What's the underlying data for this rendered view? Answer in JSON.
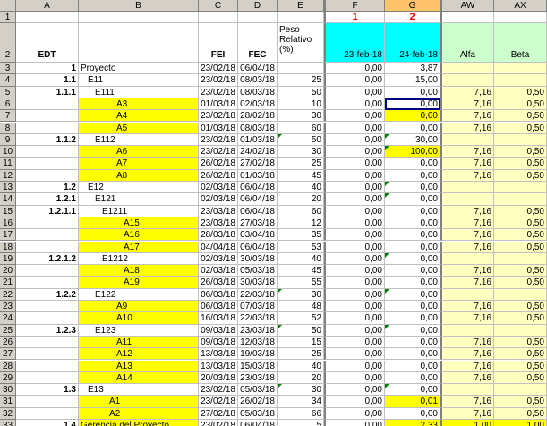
{
  "columns": [
    "A",
    "B",
    "C",
    "D",
    "E",
    "F",
    "G",
    "AW",
    "AX"
  ],
  "markers": {
    "F": "1",
    "G": "2"
  },
  "header_row": {
    "edt": "EDT",
    "fei": "FEI",
    "fec": "FEC",
    "peso": "Peso Relativo (%)",
    "f": "23-feb-18",
    "g": "24-feb-18",
    "aw": "Alfa",
    "ax": "Beta"
  },
  "rows": [
    {
      "n": "3",
      "a": "1",
      "b": "Proyecto",
      "c": "23/02/18",
      "d": "06/04/18",
      "e": "",
      "f": "0,00",
      "g": "3,87",
      "aw": "",
      "ax": ""
    },
    {
      "n": "4",
      "a": "1.1",
      "b": "E11",
      "c": "23/02/18",
      "d": "08/03/18",
      "e": "25",
      "f": "0,00",
      "g": "15,00",
      "aw": "",
      "ax": ""
    },
    {
      "n": "5",
      "a": "1.1.1",
      "b": "E111",
      "c": "23/02/18",
      "d": "08/03/18",
      "e": "50",
      "f": "0,00",
      "g": "0,00",
      "aw": "7,16",
      "ax": "0,50"
    },
    {
      "n": "6",
      "a": "",
      "b": "A3",
      "c": "01/03/18",
      "d": "02/03/18",
      "e": "10",
      "f": "0,00",
      "g": "0,00",
      "aw": "7,16",
      "ax": "0,50"
    },
    {
      "n": "7",
      "a": "",
      "b": "A4",
      "c": "23/02/18",
      "d": "28/02/18",
      "e": "30",
      "f": "0,00",
      "g": "0,00",
      "aw": "7,16",
      "ax": "0,50"
    },
    {
      "n": "8",
      "a": "",
      "b": "A5",
      "c": "01/03/18",
      "d": "08/03/18",
      "e": "60",
      "f": "0,00",
      "g": "0,00",
      "aw": "7,16",
      "ax": "0,50"
    },
    {
      "n": "9",
      "a": "1.1.2",
      "b": "E112",
      "c": "23/02/18",
      "d": "01/03/18",
      "e": "50",
      "f": "0,00",
      "g": "30,00",
      "aw": "",
      "ax": ""
    },
    {
      "n": "10",
      "a": "",
      "b": "A6",
      "c": "23/02/18",
      "d": "24/02/18",
      "e": "30",
      "f": "0,00",
      "g": "100,00",
      "aw": "7,16",
      "ax": "0,50"
    },
    {
      "n": "11",
      "a": "",
      "b": "A7",
      "c": "26/02/18",
      "d": "27/02/18",
      "e": "25",
      "f": "0,00",
      "g": "0,00",
      "aw": "7,16",
      "ax": "0,50"
    },
    {
      "n": "12",
      "a": "",
      "b": "A8",
      "c": "26/02/18",
      "d": "01/03/18",
      "e": "45",
      "f": "0,00",
      "g": "0,00",
      "aw": "7,16",
      "ax": "0,50"
    },
    {
      "n": "13",
      "a": "1.2",
      "b": "E12",
      "c": "02/03/18",
      "d": "06/04/18",
      "e": "40",
      "f": "0,00",
      "g": "0,00",
      "aw": "",
      "ax": ""
    },
    {
      "n": "14",
      "a": "1.2.1",
      "b": "E121",
      "c": "02/03/18",
      "d": "06/04/18",
      "e": "20",
      "f": "0,00",
      "g": "0,00",
      "aw": "",
      "ax": ""
    },
    {
      "n": "15",
      "a": "1.2.1.1",
      "b": "E1211",
      "c": "23/03/18",
      "d": "06/04/18",
      "e": "60",
      "f": "0,00",
      "g": "0,00",
      "aw": "7,16",
      "ax": "0,50"
    },
    {
      "n": "16",
      "a": "",
      "b": "A15",
      "c": "23/03/18",
      "d": "27/03/18",
      "e": "12",
      "f": "0,00",
      "g": "0,00",
      "aw": "7,16",
      "ax": "0,50"
    },
    {
      "n": "17",
      "a": "",
      "b": "A16",
      "c": "28/03/18",
      "d": "03/04/18",
      "e": "35",
      "f": "0,00",
      "g": "0,00",
      "aw": "7,16",
      "ax": "0,50"
    },
    {
      "n": "18",
      "a": "",
      "b": "A17",
      "c": "04/04/18",
      "d": "06/04/18",
      "e": "53",
      "f": "0,00",
      "g": "0,00",
      "aw": "7,16",
      "ax": "0,50"
    },
    {
      "n": "19",
      "a": "1.2.1.2",
      "b": "E1212",
      "c": "02/03/18",
      "d": "30/03/18",
      "e": "40",
      "f": "0,00",
      "g": "0,00",
      "aw": "",
      "ax": ""
    },
    {
      "n": "20",
      "a": "",
      "b": "A18",
      "c": "02/03/18",
      "d": "05/03/18",
      "e": "45",
      "f": "0,00",
      "g": "0,00",
      "aw": "7,16",
      "ax": "0,50"
    },
    {
      "n": "21",
      "a": "",
      "b": "A19",
      "c": "26/03/18",
      "d": "30/03/18",
      "e": "55",
      "f": "0,00",
      "g": "0,00",
      "aw": "7,16",
      "ax": "0,50"
    },
    {
      "n": "22",
      "a": "1.2.2",
      "b": "E122",
      "c": "06/03/18",
      "d": "22/03/18",
      "e": "30",
      "f": "0,00",
      "g": "0,00",
      "aw": "",
      "ax": ""
    },
    {
      "n": "23",
      "a": "",
      "b": "A9",
      "c": "06/03/18",
      "d": "07/03/18",
      "e": "48",
      "f": "0,00",
      "g": "0,00",
      "aw": "7,16",
      "ax": "0,50"
    },
    {
      "n": "24",
      "a": "",
      "b": "A10",
      "c": "16/03/18",
      "d": "22/03/18",
      "e": "52",
      "f": "0,00",
      "g": "0,00",
      "aw": "7,16",
      "ax": "0,50"
    },
    {
      "n": "25",
      "a": "1.2.3",
      "b": "E123",
      "c": "09/03/18",
      "d": "23/03/18",
      "e": "50",
      "f": "0,00",
      "g": "0,00",
      "aw": "",
      "ax": ""
    },
    {
      "n": "26",
      "a": "",
      "b": "A11",
      "c": "09/03/18",
      "d": "12/03/18",
      "e": "15",
      "f": "0,00",
      "g": "0,00",
      "aw": "7,16",
      "ax": "0,50"
    },
    {
      "n": "27",
      "a": "",
      "b": "A12",
      "c": "13/03/18",
      "d": "19/03/18",
      "e": "25",
      "f": "0,00",
      "g": "0,00",
      "aw": "7,16",
      "ax": "0,50"
    },
    {
      "n": "28",
      "a": "",
      "b": "A13",
      "c": "13/03/18",
      "d": "15/03/18",
      "e": "40",
      "f": "0,00",
      "g": "0,00",
      "aw": "7,16",
      "ax": "0,50"
    },
    {
      "n": "29",
      "a": "",
      "b": "A14",
      "c": "20/03/18",
      "d": "23/03/18",
      "e": "20",
      "f": "0,00",
      "g": "0,00",
      "aw": "7,16",
      "ax": "0,50"
    },
    {
      "n": "30",
      "a": "1.3",
      "b": "E13",
      "c": "23/02/18",
      "d": "05/03/18",
      "e": "30",
      "f": "0,00",
      "g": "0,00",
      "aw": "",
      "ax": ""
    },
    {
      "n": "31",
      "a": "",
      "b": "A1",
      "c": "23/02/18",
      "d": "26/02/18",
      "e": "34",
      "f": "0,00",
      "g": "0,01",
      "aw": "7,16",
      "ax": "0,50"
    },
    {
      "n": "32",
      "a": "",
      "b": "A2",
      "c": "27/02/18",
      "d": "05/03/18",
      "e": "66",
      "f": "0,00",
      "g": "0,00",
      "aw": "7,16",
      "ax": "0,50"
    },
    {
      "n": "33",
      "a": "1.4",
      "b": "Gerencia del Proyecto",
      "c": "23/02/18",
      "d": "06/04/18",
      "e": "5",
      "f": "0,00",
      "g": "2,33",
      "aw": "1,00",
      "ax": "1,00"
    }
  ]
}
